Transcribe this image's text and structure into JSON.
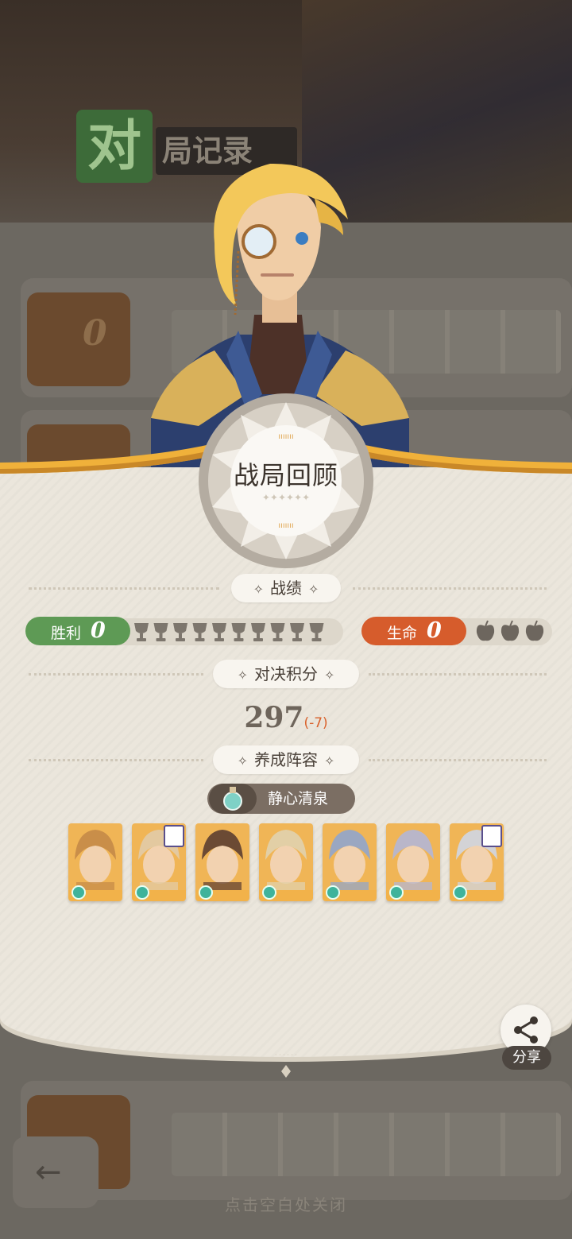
{
  "panel": {
    "title": "战局回顾",
    "sections": {
      "record": "战绩",
      "duel_score": "对决积分",
      "lineup": "养成阵容"
    },
    "wins": {
      "label": "胜利",
      "value": "0",
      "trophies_total": 10,
      "trophies_earned": 0
    },
    "life": {
      "label": "生命",
      "value": "0",
      "hearts_total": 3,
      "hearts_remaining": 0
    },
    "score": {
      "value": "297",
      "delta": "(-7)"
    },
    "lineup_name": "静心清泉",
    "heroes": [
      {
        "name": "hero-elf",
        "color": "#c98e49",
        "has_item": false
      },
      {
        "name": "hero-sheep",
        "color": "#e3c9a0",
        "has_item": true
      },
      {
        "name": "hero-beast",
        "color": "#6b4a34",
        "has_item": false
      },
      {
        "name": "hero-lion",
        "color": "#e2cfa6",
        "has_item": false
      },
      {
        "name": "hero-rabbit",
        "color": "#9aa7c1",
        "has_item": false
      },
      {
        "name": "hero-mage",
        "color": "#b9b6c9",
        "has_item": false
      },
      {
        "name": "hero-wolf",
        "color": "#d3d3d6",
        "has_item": true
      }
    ]
  },
  "share_label": "分享",
  "close_hint": "点击空白处关闭",
  "background": {
    "logo_char": "对",
    "logo_word": "局记录",
    "trophy_score": "0"
  },
  "colors": {
    "win": "#5e9a55",
    "life": "#d65c2c",
    "gold": "#f0b13a",
    "panel": "#ebe6dc"
  }
}
